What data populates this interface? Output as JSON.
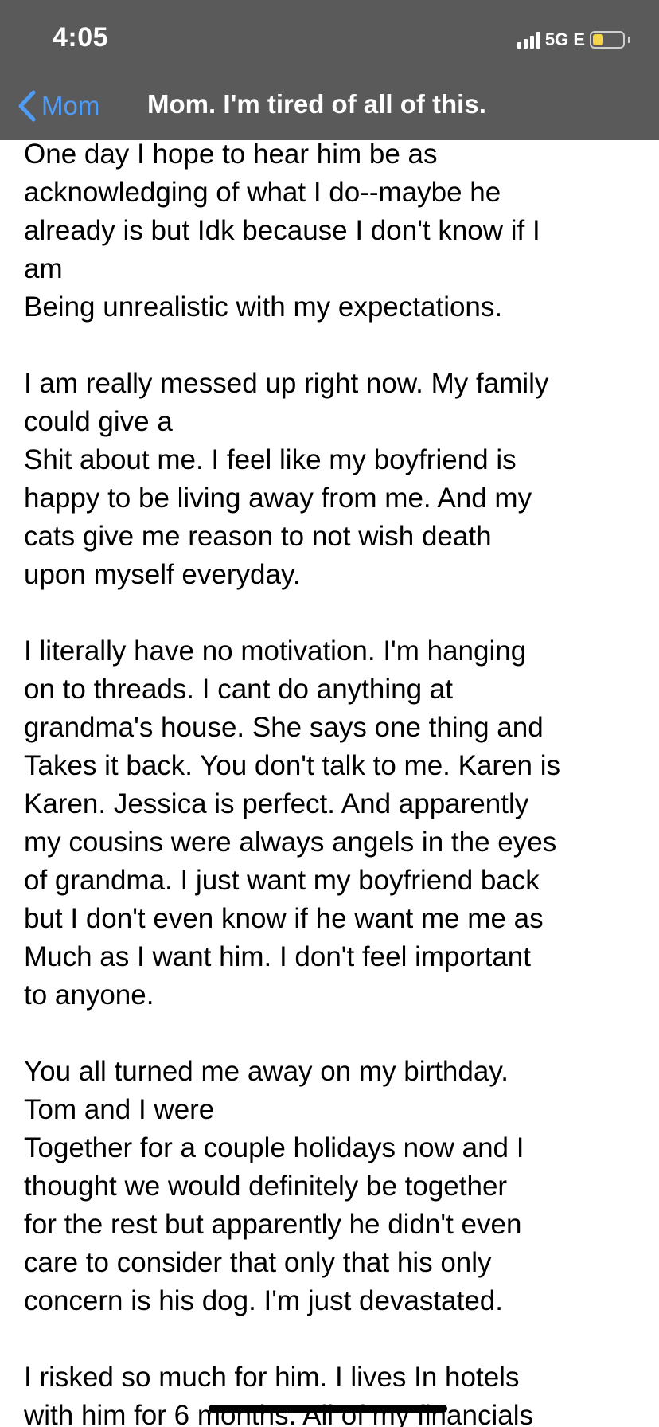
{
  "status_bar": {
    "time": "4:05",
    "network": "5G E",
    "battery_level": 0.35,
    "icons": [
      "signal-icon",
      "battery-icon"
    ],
    "battery_color": "#f4d44a"
  },
  "nav": {
    "back_label": "Mom",
    "title": "Mom. I'm tired of all of this.",
    "accent_color": "#4f9cf7",
    "icons": [
      "chevron-left-icon"
    ]
  },
  "note": {
    "lines": [
      "One day I hope to hear him be as",
      "acknowledging of what I do--maybe he",
      "already is but Idk because I don't know if I",
      "am",
      "Being unrealistic with my expectations.",
      "",
      "I am really messed up right now. My family",
      "could give a",
      "Shit about me. I feel like my boyfriend is",
      "happy to be living away from me. And my",
      "cats give me reason to not wish death",
      "upon myself everyday.",
      "",
      "I literally have no motivation. I'm hanging",
      "on to threads. I cant do anything at",
      "grandma's house. She says one thing and",
      "Takes it back. You don't talk to me. Karen is",
      "Karen. Jessica is perfect. And apparently",
      "my cousins were always angels in the eyes",
      "of grandma. I just want my boyfriend back",
      "but I don't even know if he want me me as",
      "Much as I want him. I don't feel important",
      "to anyone.",
      "",
      "You all turned me away on my birthday.",
      "Tom and I were",
      "Together for a couple holidays now and I",
      "thought we would definitely be together",
      "for the rest but apparently he didn't even",
      "care to consider that only that his only",
      "concern is his dog. I'm just devastated.",
      "",
      "I risked so much for him. I lives In hotels",
      "with him for 6 months. All of my financials"
    ]
  }
}
